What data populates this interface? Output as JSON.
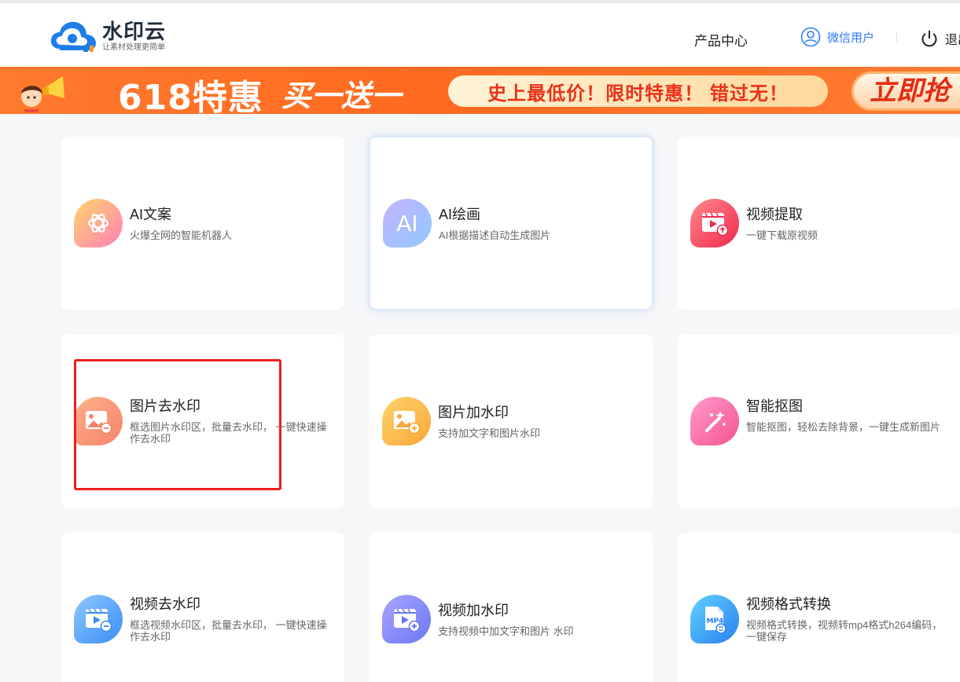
{
  "header": {
    "logo_title": "水印云",
    "logo_subtitle": "让素材处理更简单",
    "nav_products": "产品中心",
    "user_label": "微信用户",
    "exit_label": "退出"
  },
  "banner": {
    "headline": "618特惠",
    "bogo": "买一送一",
    "pill_text": "史上最低价！限时特惠！ 错过无！",
    "cta": "立即抢"
  },
  "cards": [
    {
      "title": "AI文案",
      "desc": "火爆全网的智能机器人",
      "icon": "openai-icon"
    },
    {
      "title": "AI绘画",
      "desc": "AI根据描述自动生成图片",
      "icon": "ai-text-icon",
      "icon_text": "AI"
    },
    {
      "title": "视频提取",
      "desc": "一键下载原视频",
      "icon": "video-download-icon"
    },
    {
      "title": "图片去水印",
      "desc": "框选图片水印区，批量去水印， 一键快速操作去水印",
      "icon": "image-remove-icon"
    },
    {
      "title": "图片加水印",
      "desc": "支持加文字和图片水印",
      "icon": "image-add-icon"
    },
    {
      "title": "智能抠图",
      "desc": "智能抠图，轻松去除背景，一键生成新图片",
      "icon": "magic-wand-icon"
    },
    {
      "title": "视频去水印",
      "desc": "框选视频水印区，批量去水印， 一键快速操作去水印",
      "icon": "video-remove-icon"
    },
    {
      "title": "视频加水印",
      "desc": "支持视频中加文字和图片 水印",
      "icon": "video-add-icon"
    },
    {
      "title": "视频格式转换",
      "desc": "视频格式转换，视频转mp4格式h264编码，一键保存",
      "icon": "mp4-file-icon",
      "icon_text": "MP4"
    }
  ],
  "colors": {
    "brand_blue": "#2e7cf6",
    "banner_orange": "#ff6a1f",
    "highlight_red": "#ef1d1d"
  }
}
